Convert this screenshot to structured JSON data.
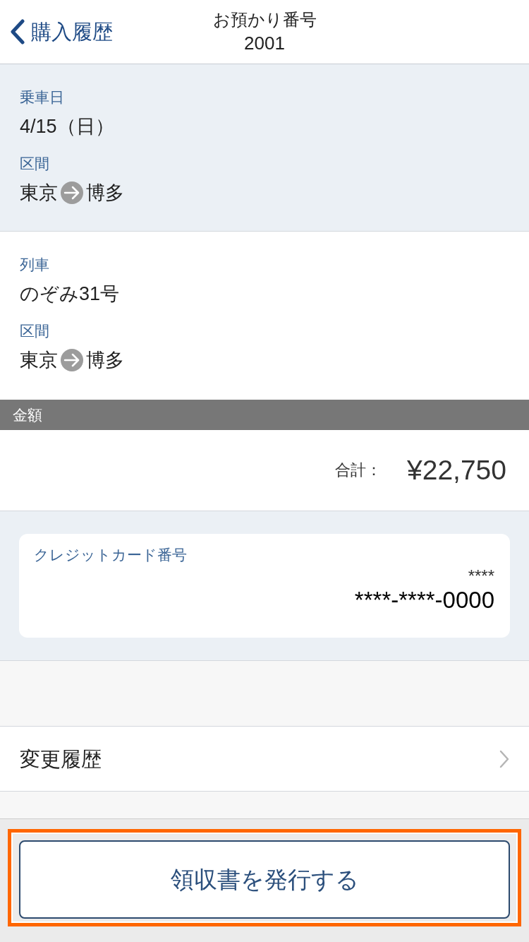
{
  "header": {
    "back_label": "購入履歴",
    "title": "お預かり番号",
    "subtitle": "2001"
  },
  "sections": [
    {
      "shaded": true,
      "fields": [
        {
          "kind": "text",
          "label": "乗車日",
          "value": "4/15（日）"
        },
        {
          "kind": "route",
          "label": "区間",
          "from": "東京",
          "to": "博多"
        }
      ]
    },
    {
      "shaded": false,
      "fields": [
        {
          "kind": "text",
          "label": "列車",
          "value": "のぞみ31号"
        },
        {
          "kind": "route",
          "label": "区間",
          "from": "東京",
          "to": "博多"
        }
      ]
    }
  ],
  "amount": {
    "heading": "金額",
    "total_label": "合計：",
    "total": "¥22,750"
  },
  "card": {
    "label": "クレジットカード番号",
    "line_1": "****",
    "line_2": "****-****-0000"
  },
  "menu_items": [
    {
      "label": "変更履歴"
    }
  ],
  "receipt_button": {
    "label": "領収書を発行する",
    "highlighted": true
  }
}
